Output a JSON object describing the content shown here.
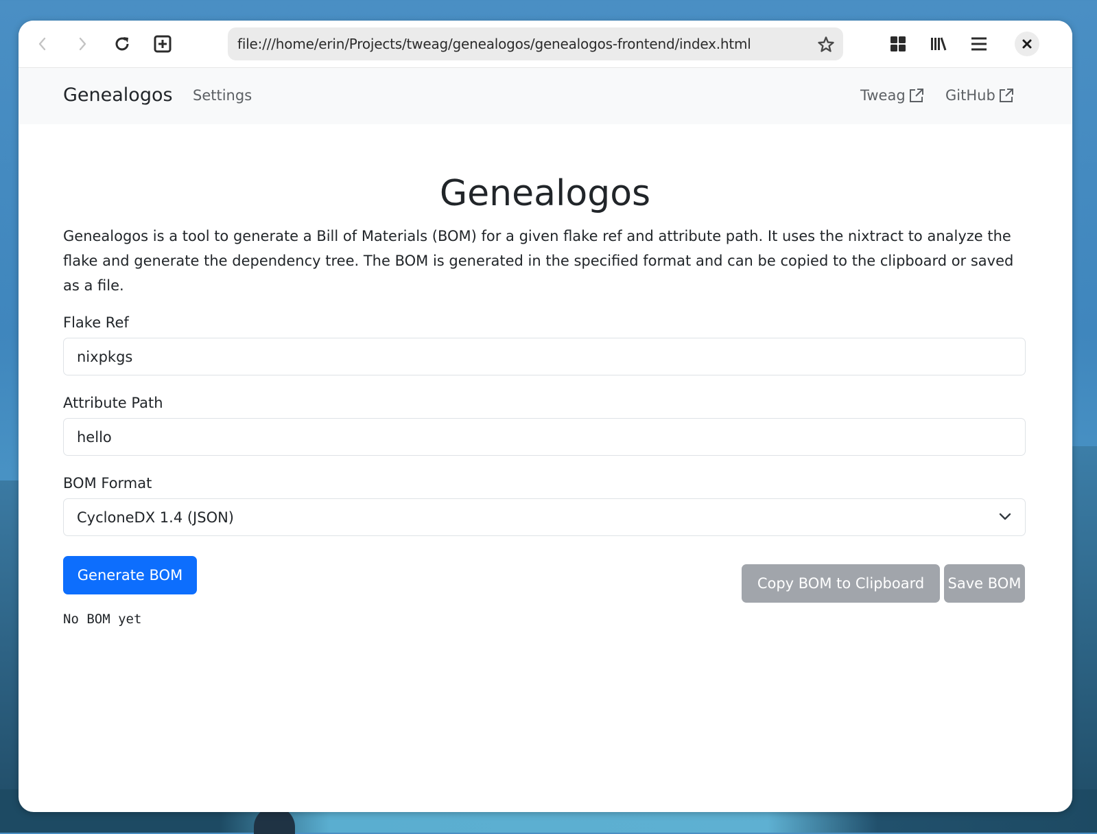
{
  "browser": {
    "url": "file:///home/erin/Projects/tweag/genealogos/genealogos-frontend/index.html",
    "icons": {
      "back": "chevron-left-icon",
      "forward": "chevron-right-icon",
      "reload": "reload-icon",
      "new_tab": "plus-square-icon",
      "bookmark": "star-icon",
      "extensions": "grid-icon",
      "library": "library-icon",
      "menu": "hamburger-icon",
      "close": "close-icon"
    }
  },
  "navbar": {
    "brand": "Genealogos",
    "settings": "Settings",
    "links": [
      {
        "label": "Tweag",
        "icon": "external-link-icon"
      },
      {
        "label": "GitHub",
        "icon": "external-link-icon"
      }
    ]
  },
  "main": {
    "title": "Genealogos",
    "description": "Genealogos is a tool to generate a Bill of Materials (BOM) for a given flake ref and attribute path. It uses the nixtract to analyze the flake and generate the dependency tree. The BOM is generated in the specified format and can be copied to the clipboard or saved as a file.",
    "form": {
      "flake_ref": {
        "label": "Flake Ref",
        "value": "nixpkgs"
      },
      "attribute_path": {
        "label": "Attribute Path",
        "value": "hello"
      },
      "bom_format": {
        "label": "BOM Format",
        "selected": "CycloneDX 1.4 (JSON)"
      }
    },
    "buttons": {
      "generate": "Generate BOM",
      "copy": "Copy BOM to Clipboard",
      "save": "Save BOM"
    },
    "output": "No BOM yet"
  },
  "colors": {
    "primary": "#0d6efd",
    "secondary_disabled": "#a1a5ab",
    "navbar_bg": "#f8f9fa"
  }
}
